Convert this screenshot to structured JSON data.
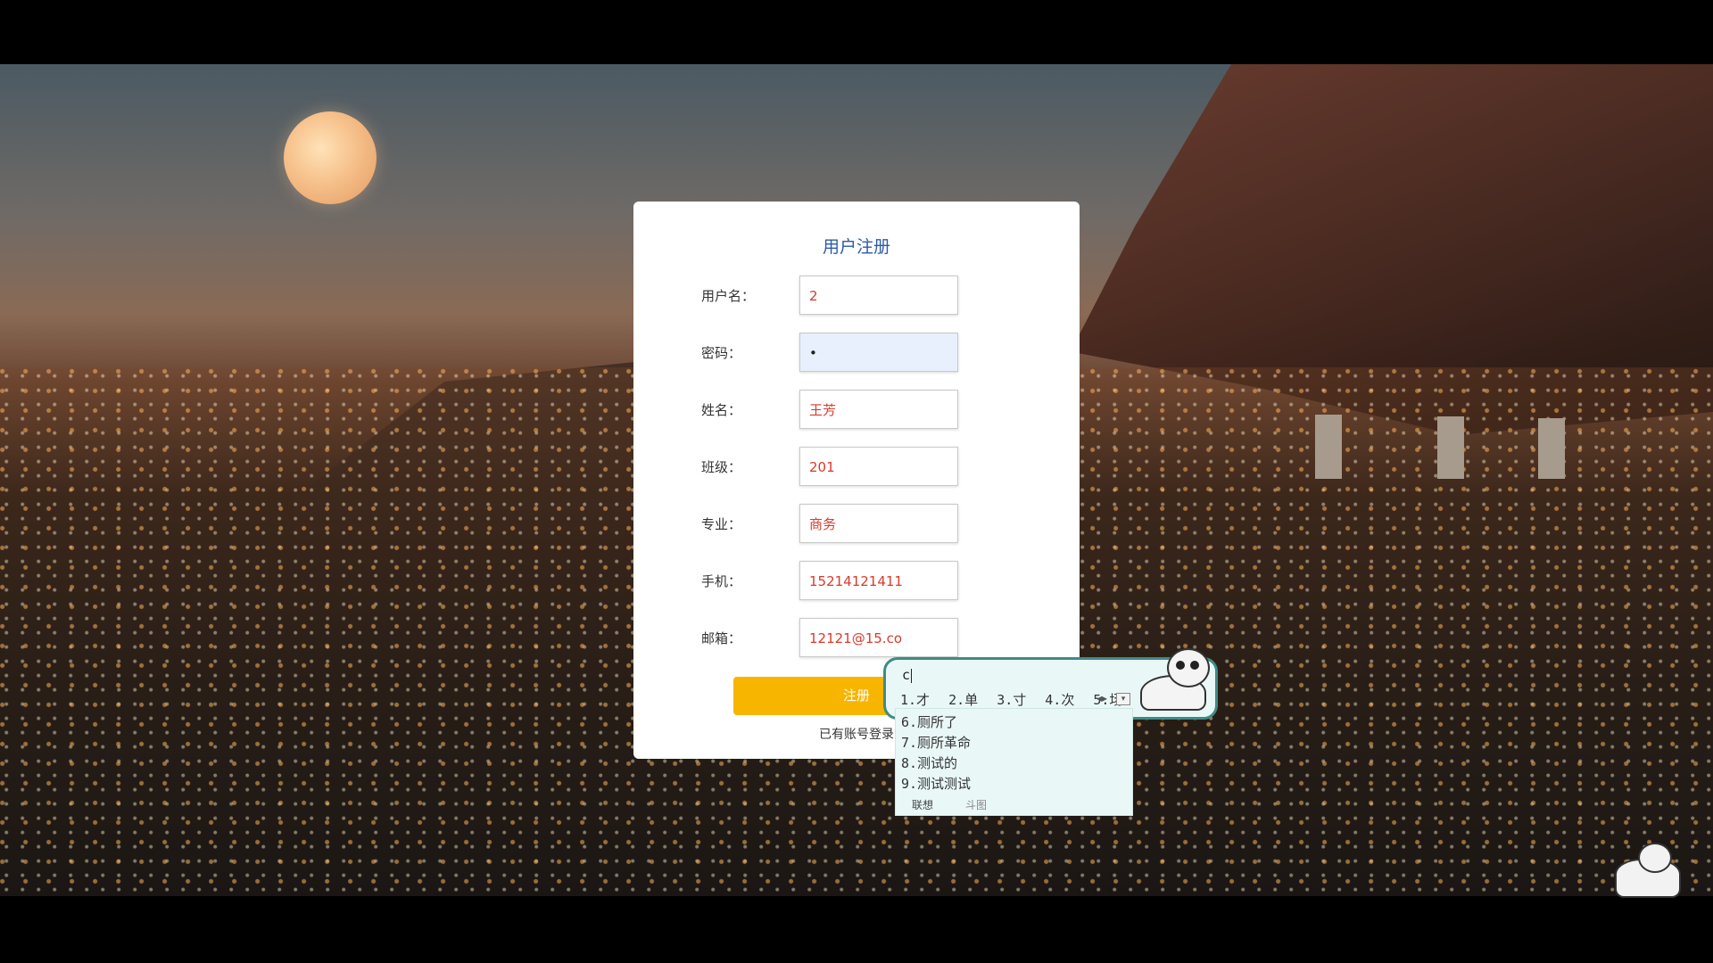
{
  "form": {
    "title": "用户注册",
    "fields": [
      {
        "label": "用户名：",
        "value": "2"
      },
      {
        "label": "密码：",
        "value": "•"
      },
      {
        "label": "姓名：",
        "value": "王芳"
      },
      {
        "label": "班级：",
        "value": "201"
      },
      {
        "label": "专业：",
        "value": "商务"
      },
      {
        "label": "手机：",
        "value": "15214121411"
      },
      {
        "label": "邮箱：",
        "value": "12121@15.co"
      }
    ],
    "register_label": "注册",
    "login_link": "已有账号登录"
  },
  "ime": {
    "input": "c",
    "inline_candidates": [
      "1.才",
      "2.单",
      "3.寸",
      "4.次",
      "5.场"
    ],
    "list_candidates": [
      "6.厕所了",
      "7.厕所革命",
      "8.测试的",
      "9.测试测试"
    ],
    "footer": [
      "联想",
      "斗图"
    ]
  },
  "colors": {
    "title": "#2c5aa8",
    "field_text": "#d83a2c",
    "button": "#f7b500",
    "ime_border": "#3f8b84"
  }
}
